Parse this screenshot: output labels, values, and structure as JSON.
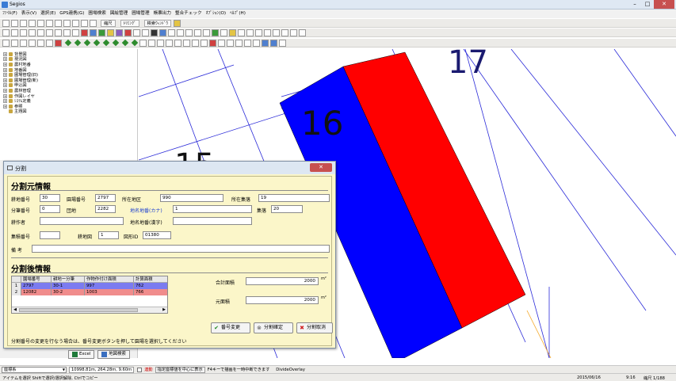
{
  "window": {
    "title": "Segios"
  },
  "menu": [
    "ﾌｧｲﾙ(F)",
    "表示(V)",
    "選択(E)",
    "GPS連携(G)",
    "圃場検索",
    "図絵管理",
    "圃場管理",
    "帳票出力",
    "整合チェック",
    "ｵﾌﾟｼｮﾝ(O)",
    "ﾍﾙﾌﾟ(H)"
  ],
  "toolbar": {
    "trim_label": "縮尺",
    "grid_label": "ﾄﾘﾐﾝｸﾞ",
    "search_label": "検索ｳｨﾝﾄﾞｳ"
  },
  "tree": [
    "背景図",
    "現況図",
    "農村地番",
    "地番図",
    "圃場管理(旧)",
    "圃場管理(新)",
    "申込図",
    "農林管理",
    "作図レイヤ",
    "ｼｽﾃﾑ定義",
    "参照",
    "主題図"
  ],
  "map": {
    "labels": [
      "17",
      "16",
      "15"
    ]
  },
  "dialog": {
    "title": "分割",
    "close_label": "✕",
    "source_section": "分割元情報",
    "fields": {
      "kouchi_bango_label": "耕地番号",
      "kouchi_bango": "30",
      "enjou_bango_label": "園場番号",
      "enjou_bango": "2797",
      "shozai_chiku_label": "所在地区",
      "shozai_chiku": "990",
      "shozai_shuraku_label": "所在集落",
      "shozai_shuraku": "19",
      "bunkatsu_bango_label": "分筆番号",
      "bunkatsu_bango": "0",
      "dan_chi_label": "団地",
      "dan_chi": "2282",
      "chimei_kana_label": "地名地番(カナ)",
      "chimei_kana": "1",
      "shuraku_label": "集落",
      "shuraku": "20",
      "kousakusha_label": "耕作者",
      "kousakusha": "",
      "chimei_kanji_label": "地名地番(漢字)",
      "chimei_kanji": "",
      "shuuei_bango_label": "集積番号",
      "shuuei_bango": "",
      "kouchi_zu_label": "耕地図",
      "kouchi_zu": "1",
      "zukei_id_label": "図形ID",
      "zukei_id": "01380",
      "bikou_label": "備 考",
      "bikou": ""
    },
    "result_section": "分割後情報",
    "grid": {
      "headers": [
        "園場番号",
        "耕地ー分筆",
        "作物作付け面積",
        "計算面積"
      ],
      "rows": [
        {
          "num": "1",
          "enjou": "2797",
          "kouchi": "30-1",
          "sakumotsu": "997",
          "keisan": "762"
        },
        {
          "num": "2",
          "enjou": "12082",
          "kouchi": "30-2",
          "sakumotsu": "1003",
          "keisan": "766"
        }
      ]
    },
    "total_area_label": "合計面積",
    "total_area": "2000",
    "total_unit": "m²",
    "orig_area_label": "元面積",
    "orig_area": "2000",
    "orig_unit": "m²",
    "btn_change": "番号変更",
    "btn_confirm": "分割確定",
    "btn_cancel": "分割取消",
    "hint": "分割番号の変更を行なう場合は、番号変更ボタンを押して園場を選択してください"
  },
  "bottom": {
    "excel": "Excel",
    "map_search": "地図検索"
  },
  "status": {
    "mode": "座標系",
    "coords": "10998.81m, 264.28m, 9.60m",
    "snap_label": "連動",
    "center_btn": "指定座標値を中心に表示",
    "f4_text": "F4キーで描画を一時中断できます",
    "overlay": "DivideOverlay",
    "hint2": "アイテムを選択 Shiftで選択/選択解除, Ctrlでコピー",
    "date": "2015/06/16",
    "time": "9:16",
    "zoom": "縮尺 1/188"
  },
  "colors": {
    "parcel_blue": "#0000ff",
    "parcel_red": "#ff0000",
    "grid_row1": "#7b7bf0",
    "grid_row2": "#f08c8c",
    "dialog_bg": "#fbf6c9"
  }
}
